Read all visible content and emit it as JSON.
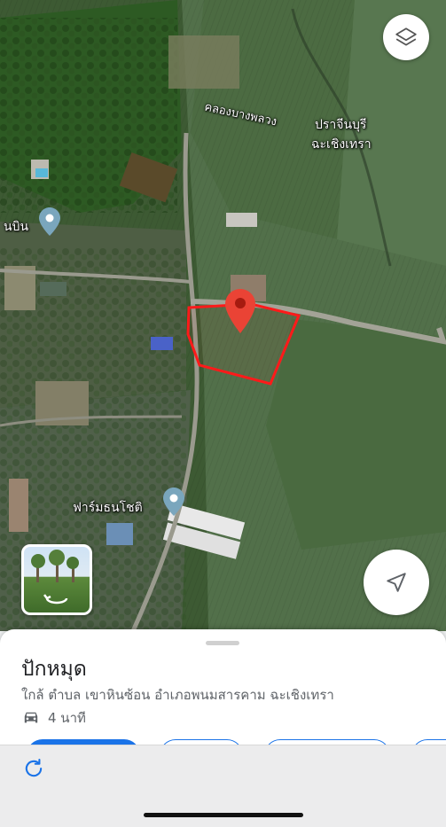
{
  "map": {
    "labels": {
      "canal": "คลองบางพลวง",
      "province_line1": "ปราจีนบุรี",
      "province_line2": "ฉะเชิงเทรา",
      "poi_left": "นบิน",
      "poi_farm": "ฟาร์มธนโชติ"
    },
    "marker_color": "#ea4335",
    "boundary_color": "#ff1a1a",
    "icons": [
      "layers-icon",
      "navigation-arrow-icon",
      "street-view-icon",
      "place-pin-icon"
    ]
  },
  "place": {
    "title": "ปักหมุด",
    "address": "ใกล้ ตำบล เขาหินซ้อน อำเภอพนมสารคาม ฉะเชิงเทรา",
    "travel_time": "4 นาที",
    "travel_icon": "car-icon"
  },
  "colors": {
    "accent": "#1a73e8",
    "sheet_bg": "#ffffff",
    "bar_bg": "#ececed"
  }
}
